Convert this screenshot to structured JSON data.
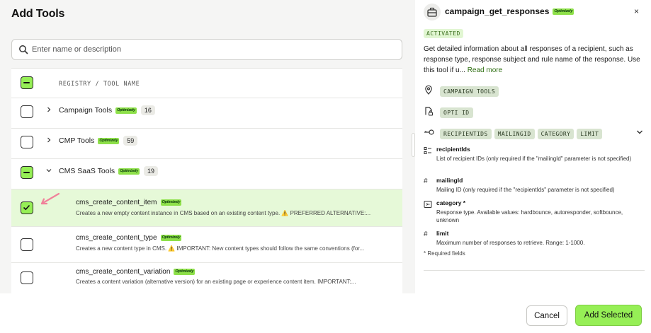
{
  "modal": {
    "title": "Add Tools"
  },
  "search": {
    "placeholder": "Enter name or description"
  },
  "list": {
    "header": "REGISTRY / TOOL NAME",
    "groups": [
      {
        "label": "Campaign Tools",
        "count": "16",
        "badge": "Optimizely"
      },
      {
        "label": "CMP Tools",
        "count": "59",
        "badge": "Optimizely"
      },
      {
        "label": "CMS SaaS Tools",
        "count": "19",
        "badge": "Optimizely"
      }
    ],
    "tools": [
      {
        "name": "cms_create_content_item",
        "badge": "Optimizely",
        "desc": "Creates a new empty content instance in CMS based on an existing content type. ⚠️ PREFERRED ALTERNATIVE:..."
      },
      {
        "name": "cms_create_content_type",
        "badge": "Optimizely",
        "desc": "Creates a new content type in CMS. ⚠️ IMPORTANT: New content types should follow the same conventions (for..."
      },
      {
        "name": "cms_create_content_variation",
        "badge": "Optimizely",
        "desc": "Creates a content variation (alternative version) for an existing page or experience content item. IMPORTANT:..."
      }
    ]
  },
  "detail": {
    "title": "campaign_get_responses",
    "badge": "Optimizely",
    "close": "×",
    "status": "ACTIVATED",
    "description": "Get detailed information about all responses of a recipient, such as response type, response subject and rule name of the response. Use this tool if u...",
    "read_more": "Read more",
    "category_chip": "CAMPAIGN TOOLS",
    "auth_chip": "OPTI ID",
    "param_chips": [
      "RECIPIENTIDS",
      "MAILINGID",
      "CATEGORY",
      "LIMIT"
    ],
    "params": [
      {
        "icon": "list",
        "name": "recipientIds",
        "desc": "List of recipient IDs (only required if the \"mailingId\" parameter is not specified)"
      },
      {
        "icon": "#",
        "name": "mailingId",
        "desc": "Mailing ID (only required if the \"recipientIds\" parameter is not specified)"
      },
      {
        "icon": "enum",
        "name": "category *",
        "desc": "Response type. Available values: hardbounce, autoresponder, softbounce, unknown"
      },
      {
        "icon": "#",
        "name": "limit",
        "desc": "Maximum number of responses to retrieve. Range: 1-1000."
      }
    ],
    "required_note": "* Required fields"
  },
  "footer": {
    "cancel": "Cancel",
    "add": "Add Selected"
  }
}
